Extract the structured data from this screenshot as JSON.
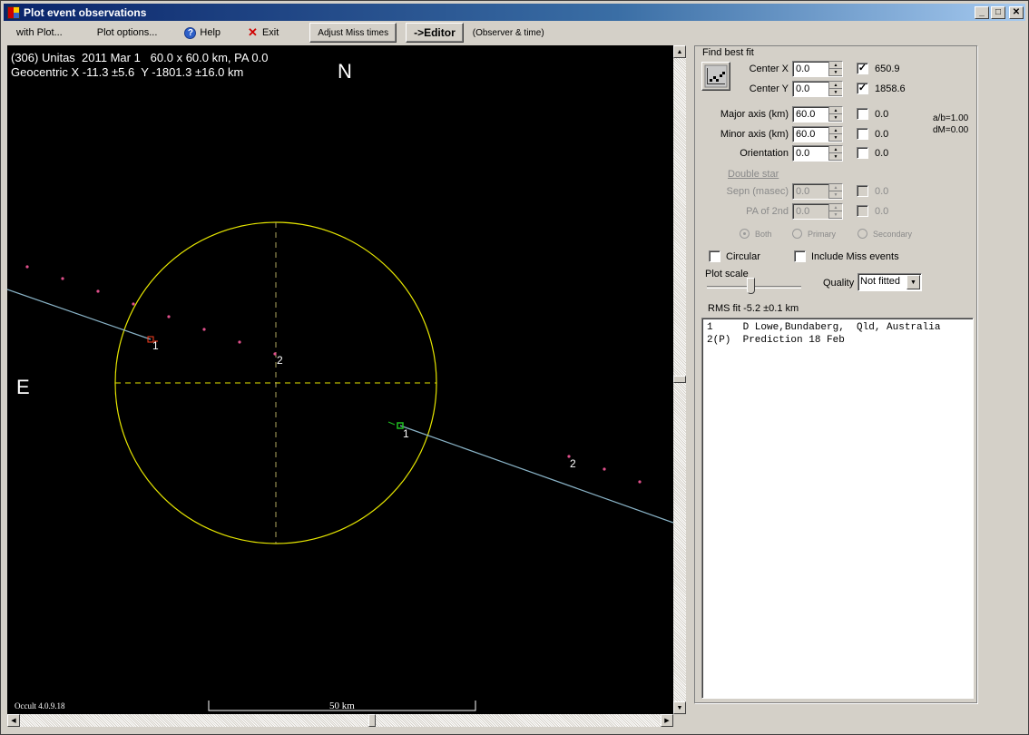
{
  "window": {
    "title": "Plot event observations",
    "controls": {
      "minimize": "_",
      "maximize": "□",
      "close": "✕"
    }
  },
  "menubar": {
    "with_plot": "with Plot...",
    "plot_options": "Plot options...",
    "help": "Help",
    "help_glyph": "?",
    "exit": "Exit",
    "exit_glyph": "✕",
    "adjust_miss": "Adjust Miss times",
    "editor": "->Editor",
    "observer_time": "(Observer & time)"
  },
  "plot": {
    "header_line1": "(306) Unitas  2011 Mar 1   60.0 x 60.0 km, PA 0.0",
    "header_line2": "Geocentric X -11.3 ±5.6  Y -1801.3 ±16.0 km",
    "north_label": "N",
    "east_label": "E",
    "version": "Occult 4.0.9.18",
    "scale_label": "50 km",
    "colors": {
      "background": "#000000",
      "ellipse": "#e6e600",
      "axes": "#e6e600",
      "chord": "#8ab4c8",
      "predicted_points": "#e0508c",
      "disappear_marker": "#ff4020",
      "reappear_marker": "#20c020",
      "text": "#ffffff"
    },
    "chord_labels": [
      {
        "id": "obs1-d",
        "text": "1"
      },
      {
        "id": "obs1-r",
        "text": "1"
      },
      {
        "id": "pred2-a",
        "text": "2"
      },
      {
        "id": "pred2-b",
        "text": "2"
      }
    ]
  },
  "panel": {
    "group_title": "Find best fit",
    "rows": [
      {
        "label": "Center X",
        "value": "0.0",
        "checked": true,
        "result": "650.9"
      },
      {
        "label": "Center Y",
        "value": "0.0",
        "checked": true,
        "result": "1858.6"
      },
      {
        "label": "Major axis (km)",
        "value": "60.0",
        "checked": false,
        "result": "0.0"
      },
      {
        "label": "Minor axis (km)",
        "value": "60.0",
        "checked": false,
        "result": "0.0"
      },
      {
        "label": "Orientation",
        "value": "0.0",
        "checked": false,
        "result": "0.0"
      }
    ],
    "ratio": "a/b=1.00",
    "dm": "dM=0.00",
    "double_star": {
      "title": "Double star",
      "rows": [
        {
          "label": "Sepn (masec)",
          "value": "0.0",
          "checked": false,
          "result": "0.0"
        },
        {
          "label": "PA of 2nd",
          "value": "0.0",
          "checked": false,
          "result": "0.0"
        }
      ],
      "radios": [
        {
          "label": "Both",
          "selected": true
        },
        {
          "label": "Primary",
          "selected": false
        },
        {
          "label": "Secondary",
          "selected": false
        }
      ]
    },
    "circular": {
      "label": "Circular",
      "checked": false
    },
    "include_miss": {
      "label": "Include Miss events",
      "checked": false
    },
    "plot_scale_label": "Plot scale",
    "plot_scale_fraction": 0.45,
    "quality_label": "Quality",
    "quality_value": "Not fitted",
    "rms": "RMS fit -5.2 ±0.1 km",
    "observers": [
      "1     D Lowe,Bundaberg,  Qld, Australia",
      "2(P)  Prediction 18 Feb"
    ]
  }
}
